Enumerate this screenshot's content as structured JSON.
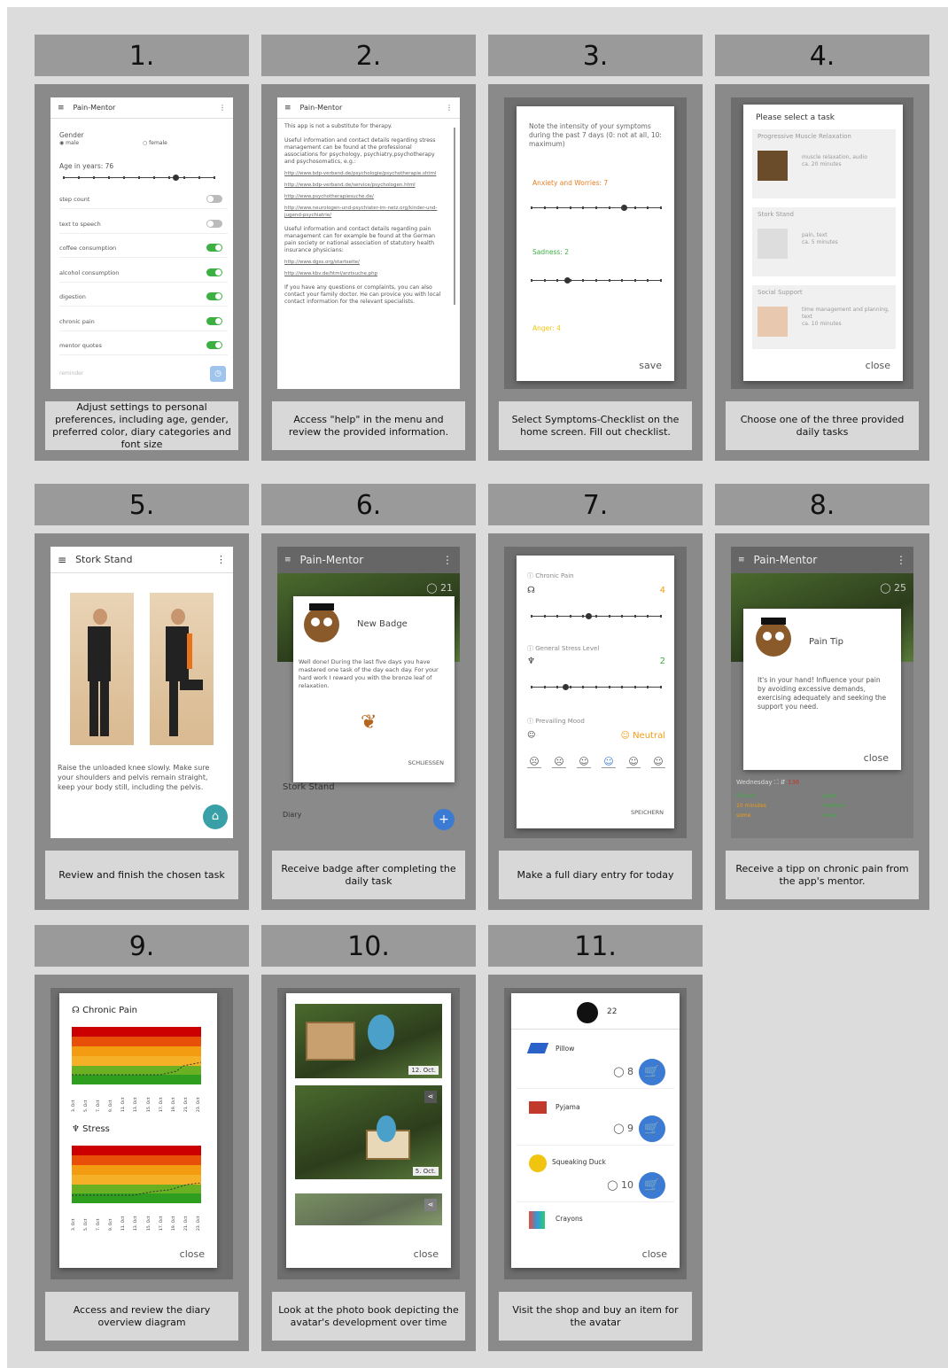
{
  "steps": [
    {
      "num": "1.",
      "caption": "Adjust settings to personal preferences, including age, gender, preferred color, diary categories and font size"
    },
    {
      "num": "2.",
      "caption": "Access \"help\" in the menu and review the provided information."
    },
    {
      "num": "3.",
      "caption": "Select Symptoms-Checklist on the home screen. Fill out checklist."
    },
    {
      "num": "4.",
      "caption": "Choose one of the three provided daily tasks"
    },
    {
      "num": "5.",
      "caption": "Review and finish the chosen task"
    },
    {
      "num": "6.",
      "caption": "Receive badge after completing the daily task"
    },
    {
      "num": "7.",
      "caption": "Make a full diary entry for today"
    },
    {
      "num": "8.",
      "caption": "Receive a tipp on chronic pain from the app's mentor."
    },
    {
      "num": "9.",
      "caption": "Access and review the diary overview diagram"
    },
    {
      "num": "10.",
      "caption": "Look at the photo book depicting the avatar's development over time"
    },
    {
      "num": "11.",
      "caption": "Visit the shop and buy an item for the avatar"
    }
  ],
  "s1": {
    "title": "Pain-Mentor",
    "gender": "Gender",
    "male": "male",
    "female": "female",
    "age": "Age in years: 76",
    "rows": [
      {
        "label": "step count",
        "on": false
      },
      {
        "label": "text to speech",
        "on": false
      },
      {
        "label": "coffee consumption",
        "on": true
      },
      {
        "label": "alcohol consumption",
        "on": true
      },
      {
        "label": "digestion",
        "on": true
      },
      {
        "label": "chronic pain",
        "on": true
      },
      {
        "label": "mentor quotes",
        "on": true
      }
    ],
    "reminder": "reminder"
  },
  "s2": {
    "title": "Pain-Mentor",
    "p1": "This app is not a substitute for therapy.",
    "p2": "Useful information and contact details regarding stress management can be found at the professional associations for psychology, psychiatry,psychotherapy and psychosomatics, e.g.:",
    "links1": [
      "http://www.bdp-verband.de/psychologie/psychotherapie.shtml",
      "http://www.bdp-verband.de/service/psychologen.html",
      "http://www.psychotherapiesuche.de/",
      "http://www.neurologen-und-psychiater-im-netz.org/kinder-und-jugend-psychiatrie/"
    ],
    "p3": "Useful information and contact details regarding pain management can for example be found at the German pain society or national association of statutory health insurance physicians:",
    "links2": [
      "http://www.dgss.org/startseite/",
      "http://www.kbv.de/html/arztsuche.php"
    ],
    "p4": "If you have any questions or complaints, you can also contact your family doctor. He can provice you with local contact information for the relevant specialists."
  },
  "s3": {
    "intro": "Note the intensity of your symptoms during the past 7 days (0: not at all, 10: maximum)",
    "anx": "Anxiety and Worries: 7",
    "sad": "Sadness: 2",
    "anger": "Anger: 4",
    "save": "save"
  },
  "s4": {
    "title": "Please select a task",
    "tasks": [
      {
        "name": "Progressive Muscle Relaxation",
        "d1": "muscle relaxation, audio",
        "d2": "ca. 20 minutes"
      },
      {
        "name": "Stork Stand",
        "d1": "pain, text",
        "d2": "ca. 5 minutes"
      },
      {
        "name": "Social Support",
        "d1": "time management and planning, text",
        "d2": "ca. 10 minutes"
      }
    ],
    "close": "close"
  },
  "s5": {
    "title": "Stork Stand",
    "text": "Raise the unloaded knee slowly. Make sure your shoulders and pelvis remain straight, keep your body still, including the pelvis."
  },
  "s6": {
    "title": "Pain-Mentor",
    "badge": "New Badge",
    "text": "Well done! During the last five days you have mastered one task of the day each day. For your hard work I reward you with the bronze leaf of relaxation.",
    "close": "SCHLIESSEN",
    "coins": "21",
    "bg1": "Stork Stand",
    "bg2": "Diary"
  },
  "s7": {
    "pain": "Chronic Pain",
    "painv": "4",
    "stress": "General Stress Level",
    "stressv": "2",
    "mood": "Prevailing Mood",
    "moodv": "Neutral",
    "save": "SPEICHERN"
  },
  "s8": {
    "title": "Pain-Mentor",
    "coins": "25",
    "tip": "Pain Tip",
    "text": "It's in your hand! Influence your pain by avoiding excessive demands, exercising adequately and seeking the support you need.",
    "close": "close",
    "day": "Wednesday",
    "steps": "136",
    "c1": "8 hours",
    "c2": "good",
    "c3": "10 minutes",
    "c4": "medium",
    "c5": "some",
    "c6": "none"
  },
  "s9": {
    "t1": "Chronic Pain",
    "t2": "Stress",
    "close": "close",
    "dates1": [
      "3. Oct",
      "5. Oct",
      "7. Oct",
      "9. Oct",
      "11. Oct",
      "13. Oct",
      "15. Oct",
      "17. Oct",
      "19. Oct",
      "21. Oct",
      "23. Oct"
    ]
  },
  "s10": {
    "d1": "12. Oct.",
    "d2": "5. Oct.",
    "close": "close"
  },
  "s11": {
    "coins": "22",
    "items": [
      {
        "name": "Pillow",
        "price": "8"
      },
      {
        "name": "Pyjama",
        "price": "9"
      },
      {
        "name": "Squeaking Duck",
        "price": "10"
      },
      {
        "name": "Crayons",
        "price": ""
      }
    ],
    "close": "close"
  },
  "colors": {
    "green": "#3cb043",
    "orange": "#f39c12",
    "blue": "#3b7bd4",
    "red": "#c0392b"
  }
}
